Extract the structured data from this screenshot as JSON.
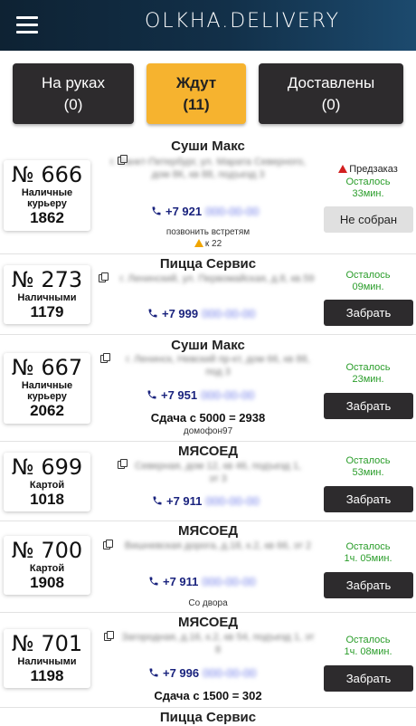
{
  "header": {
    "logo": "OLKHA.DELIVERY"
  },
  "tabs": [
    {
      "label": "На руках",
      "count": "(0)"
    },
    {
      "label": "Ждут",
      "count": "(11)"
    },
    {
      "label": "Доставлены",
      "count": "(0)"
    }
  ],
  "orders": [
    {
      "num": "№ 666",
      "pay1": "Наличные",
      "pay2": "курьеру",
      "sum": "1862",
      "shop": "Суши Макс",
      "addr": "г. Санкт-Петербург, ул. Марата Северного, дом 8К, кв 88, подъезд 3",
      "phone_code": "+7 921",
      "phone_rest": "000-00-00",
      "note": "позвонить встретям",
      "warn": "к 22",
      "preorder": "Предзаказ",
      "status1": "Осталось",
      "status2": "33мин.",
      "button": "Не собран"
    },
    {
      "num": "№ 273",
      "pay1": "Наличными",
      "pay2": "",
      "sum": "1179",
      "shop": "Пицца Сервис",
      "addr": "г. Ленинский, ул. Первомайская, д.8, кв.59",
      "phone_code": "+7 999",
      "phone_rest": "000-00-00",
      "status1": "Осталось",
      "status2": "09мин.",
      "button": "Забрать"
    },
    {
      "num": "№ 667",
      "pay1": "Наличные",
      "pay2": "курьеру",
      "sum": "2062",
      "shop": "Суши Макс",
      "addr": "г. Ленинск, Невский пр-кт, дом 66, кв 88, под 3",
      "phone_code": "+7 951",
      "phone_rest": "000-00-00",
      "change": "Сдача с 5000 = 2938",
      "note": "домофон97",
      "status1": "Осталось",
      "status2": "23мин.",
      "button": "Забрать"
    },
    {
      "num": "№ 699",
      "pay1": "Картой",
      "pay2": "",
      "sum": "1018",
      "shop": "МЯСОЕД",
      "addr": "Северная, дом 12, кв 46, подъезд 1, эт 3",
      "phone_code": "+7 911",
      "phone_rest": "000-00-00",
      "status1": "Осталось",
      "status2": "53мин.",
      "button": "Забрать"
    },
    {
      "num": "№ 700",
      "pay1": "Картой",
      "pay2": "",
      "sum": "1908",
      "shop": "МЯСОЕД",
      "addr": "Вишневская дорога, д.18, к.2, кв 66, эт 2",
      "phone_code": "+7 911",
      "phone_rest": "000-00-00",
      "note": "Со двора",
      "status1": "Осталось",
      "status2": "1ч. 05мин.",
      "button": "Забрать"
    },
    {
      "num": "№ 701",
      "pay1": "Наличными",
      "pay2": "",
      "sum": "1198",
      "shop": "МЯСОЕД",
      "addr": "Загородная, д.16, к.2, кв 54, подъезд 1, эт 8",
      "phone_code": "+7 996",
      "phone_rest": "000-00-00",
      "change": "Сдача с 1500 = 302",
      "status1": "Осталось",
      "status2": "1ч. 08мин.",
      "button": "Забрать"
    },
    {
      "shop": "Пицца Сервис"
    }
  ]
}
